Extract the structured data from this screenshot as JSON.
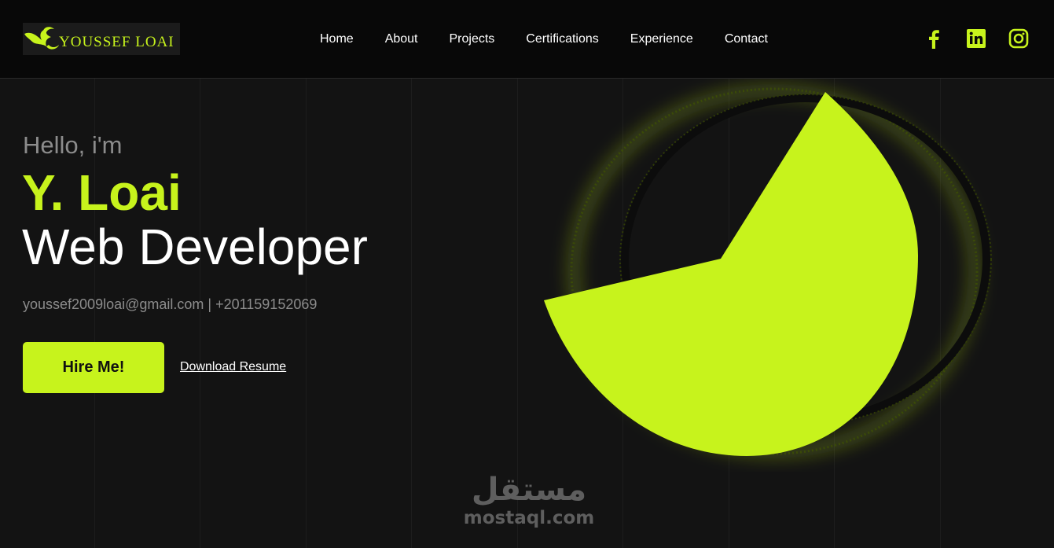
{
  "brand": {
    "logo_text": "YOUSSEF LOAI",
    "accent_color": "#c7f31c"
  },
  "nav": {
    "items": [
      {
        "label": "Home"
      },
      {
        "label": "About"
      },
      {
        "label": "Projects"
      },
      {
        "label": "Certifications"
      },
      {
        "label": "Experience"
      },
      {
        "label": "Contact"
      }
    ]
  },
  "socials": [
    {
      "icon": "facebook-icon"
    },
    {
      "icon": "linkedin-icon"
    },
    {
      "icon": "instagram-icon"
    }
  ],
  "hero": {
    "greeting": "Hello, i'm",
    "name": "Y. Loai",
    "role": "Web Developer",
    "contact": "youssef2009loai@gmail.com | +201159152069",
    "hire_label": "Hire Me!",
    "resume_label": "Download Resume"
  },
  "watermark": {
    "arabic": "مستقل",
    "latin": "mostaql.com"
  }
}
